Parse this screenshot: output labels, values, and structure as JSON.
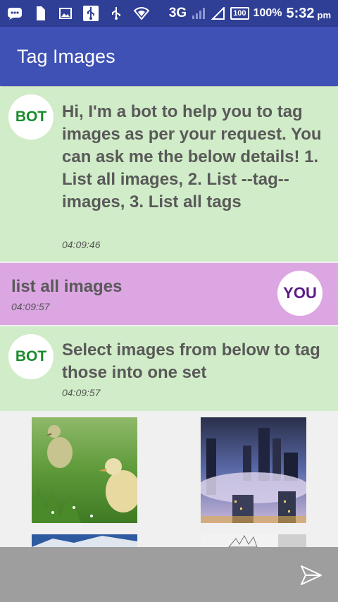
{
  "status_bar": {
    "network": "3G",
    "battery_box": "100",
    "battery_pct": "100%",
    "time": "5:32",
    "ampm": "pm",
    "icons": [
      "bbm-icon",
      "sim-icon",
      "image-icon",
      "usb-icon",
      "usb-icon",
      "wifi-icon",
      "signal-icon"
    ]
  },
  "app_bar": {
    "title": "Tag Images"
  },
  "messages": [
    {
      "sender": "bot",
      "avatar": "BOT",
      "text": "Hi, I'm a bot to help you to tag images as per your request. You can ask me the below details! 1. List all images, 2. List --tag-- images, 3. List all tags",
      "time": "04:09:46"
    },
    {
      "sender": "user",
      "avatar": "YOU",
      "text": "list all images",
      "time": "04:09:57"
    },
    {
      "sender": "bot",
      "avatar": "BOT",
      "text": "Select images from below to tag those into one set",
      "time": "04:09:57"
    }
  ],
  "images": [
    {
      "name": "ducklings-photo"
    },
    {
      "name": "city-fog-photo"
    },
    {
      "name": "mountain-photo"
    },
    {
      "name": "sketch-photo"
    }
  ],
  "colors": {
    "status_bar": "#2f3f96",
    "app_bar": "#3f51b5",
    "bot_bubble": "#d1ecc8",
    "user_bubble": "#dca6e3",
    "input_bar": "#9e9e9e"
  }
}
